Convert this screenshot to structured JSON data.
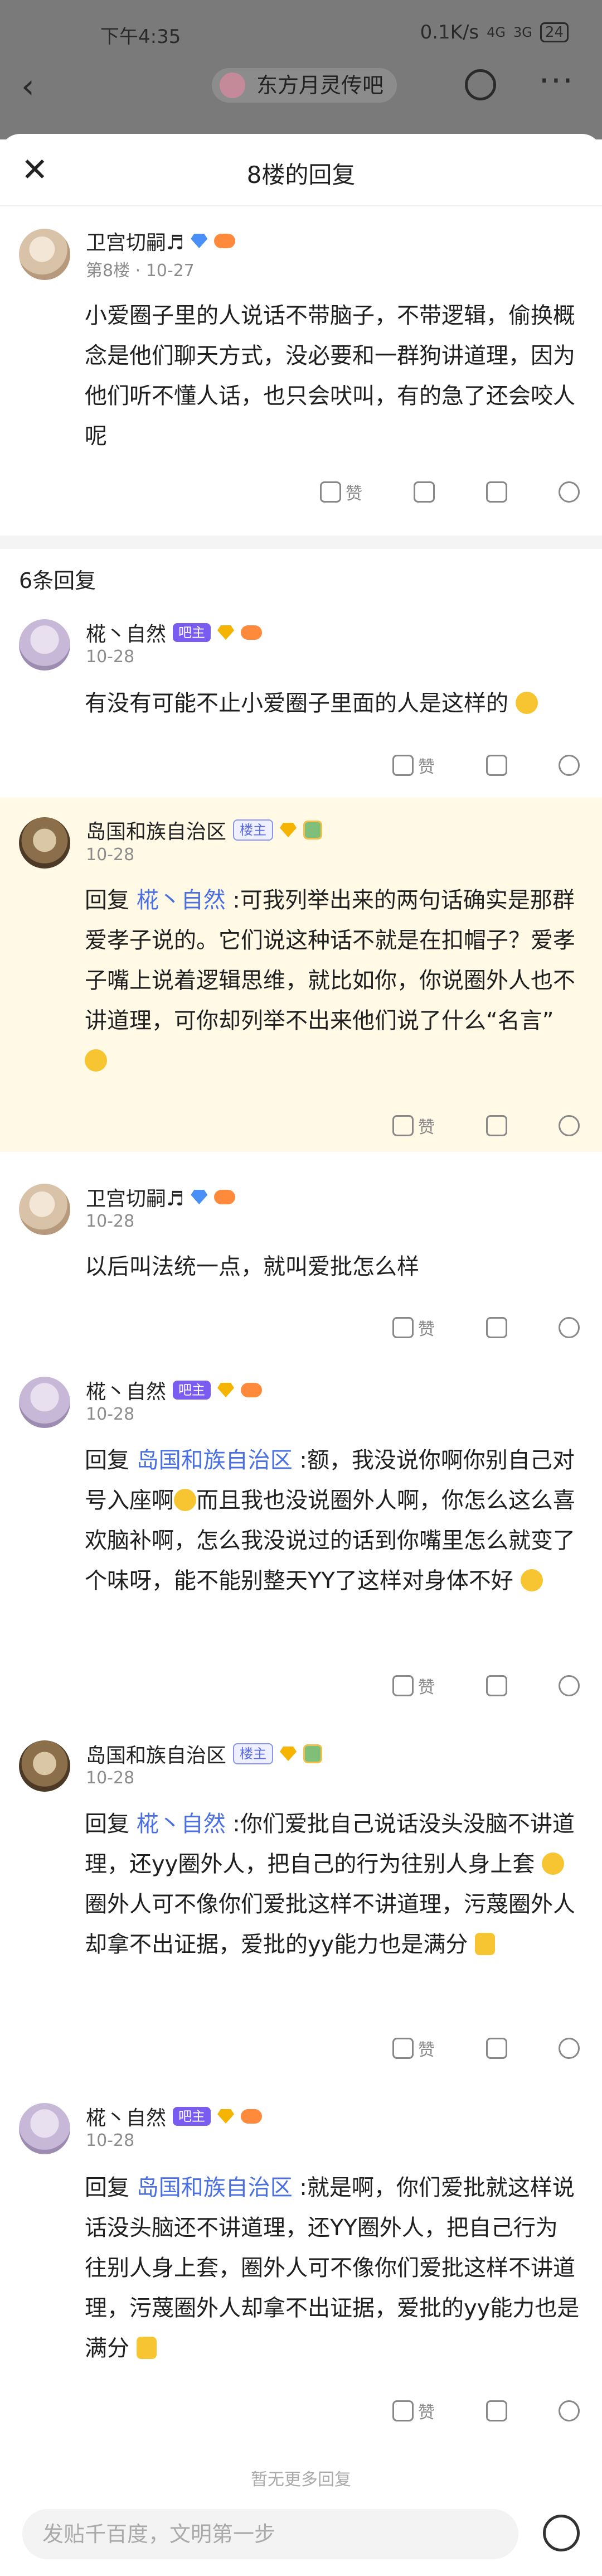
{
  "status": {
    "time": "下午4:35",
    "speed": "0.1K/s",
    "net1": "4G",
    "net2": "3G",
    "battery": "24"
  },
  "nav": {
    "forum": "东方月灵传吧"
  },
  "sheet": {
    "title": "8楼的回复",
    "reply_count": "6条回复",
    "no_more": "暂无更多回复",
    "input_placeholder": "发贴千百度，文明第一步"
  },
  "main": {
    "user": "卫宫切嗣♬",
    "floor": "第8楼",
    "date": "10-27",
    "text": "小爱圈子里的人说话不带脑子，不带逻辑，偷换概念是他们聊天方式，没必要和一群狗讲道理，因为他们听不懂人话，也只会吠叫，有的急了还会咬人呢",
    "like": "赞"
  },
  "badges": {
    "bar": "吧主",
    "host": "楼主"
  },
  "replies": [
    {
      "user": "椛丶自然",
      "date": "10-28",
      "text": "有没有可能不止小爱圈子里面的人是这样的",
      "like": "赞"
    },
    {
      "user": "岛国和族自治区",
      "date": "10-28",
      "reply_prefix": "回复",
      "reply_to": "椛丶自然",
      "text": " :可我列举出来的两句话确实是那群爱孝子说的。它们说这种话不就是在扣帽子？爱孝子嘴上说着逻辑思维，就比如你，你说圈外人也不讲道理，可你却列举不出来他们说了什么“名言”",
      "like": "赞"
    },
    {
      "user": "卫宫切嗣♬",
      "date": "10-28",
      "text": "以后叫法统一点，就叫爱批怎么样",
      "like": "赞"
    },
    {
      "user": "椛丶自然",
      "date": "10-28",
      "reply_prefix": "回复",
      "reply_to": "岛国和族自治区",
      "text_a": " :额，我没说你啊你别自己对号入座啊",
      "text_b": "而且我也没说圈外人啊，你怎么这么喜欢脑补啊，怎么我没说过的话到你嘴里怎么就变了个味呀，能不能别整天YY了这样对身体不好",
      "like": "赞"
    },
    {
      "user": "岛国和族自治区",
      "date": "10-28",
      "reply_prefix": "回复",
      "reply_to": "椛丶自然",
      "text_a": " :你们爱批自己说话没头没脑不讲道理，还yy圈外人，把自己的行为往别人身上套",
      "text_b": "圈外人可不像你们爱批这样不讲道理，污蔑圈外人却拿不出证据，爱批的yy能力也是满分",
      "like": "赞"
    },
    {
      "user": "椛丶自然",
      "date": "10-28",
      "reply_prefix": "回复",
      "reply_to": "岛国和族自治区",
      "text": " :就是啊，你们爱批就这样说话没头脑还不讲道理，还YY圈外人，把自己行为往别人身上套，圈外人可不像你们爱批这样不讲道理，污蔑圈外人却拿不出证据，爱批的yy能力也是满分",
      "like": "赞"
    }
  ]
}
